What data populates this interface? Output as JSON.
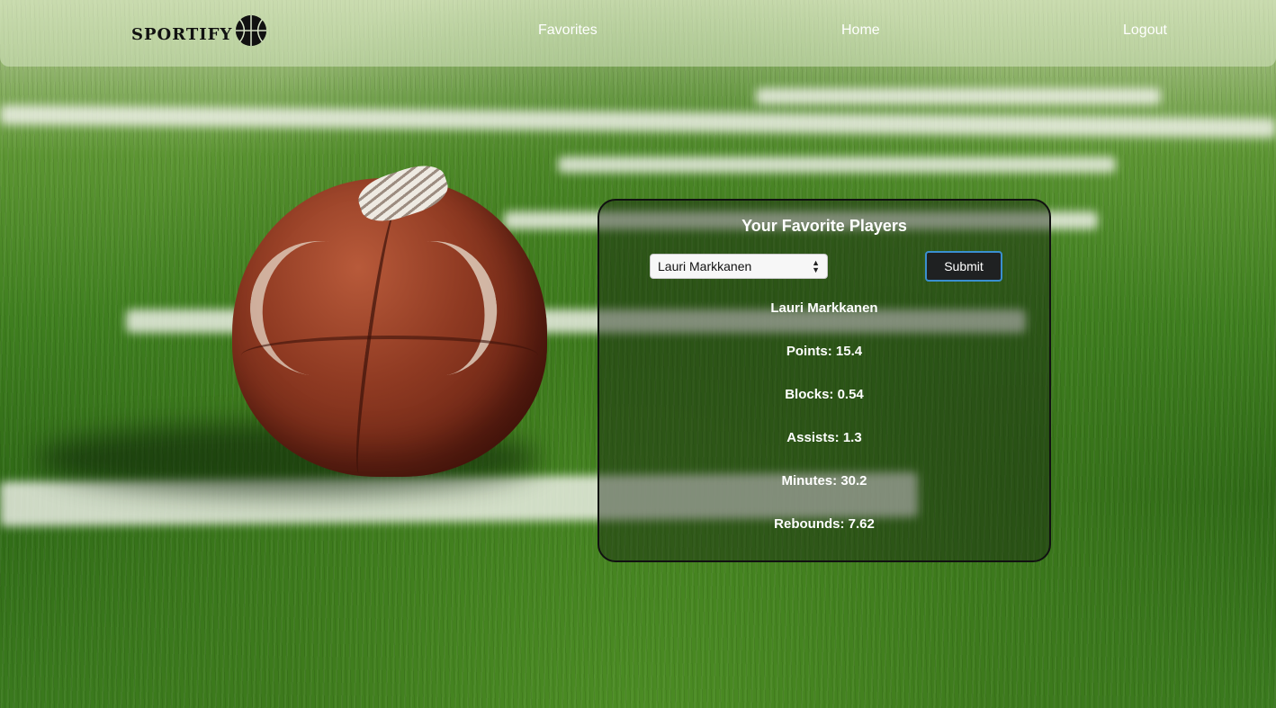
{
  "navbar": {
    "logo_text": "SPORTIFY",
    "links": {
      "favorites": "Favorites",
      "home": "Home",
      "logout": "Logout"
    }
  },
  "card": {
    "title": "Your Favorite Players",
    "select_value": "Lauri Markkanen",
    "submit_label": "Submit",
    "player_name": "Lauri Markkanen",
    "stats": {
      "points": "Points: 15.4",
      "blocks": "Blocks: 0.54",
      "assists": "Assists: 1.3",
      "minutes": "Minutes: 30.2",
      "rebounds": "Rebounds: 7.62"
    }
  },
  "colors": {
    "accent_border": "#3a8fd0",
    "button_bg": "#1f2122"
  }
}
